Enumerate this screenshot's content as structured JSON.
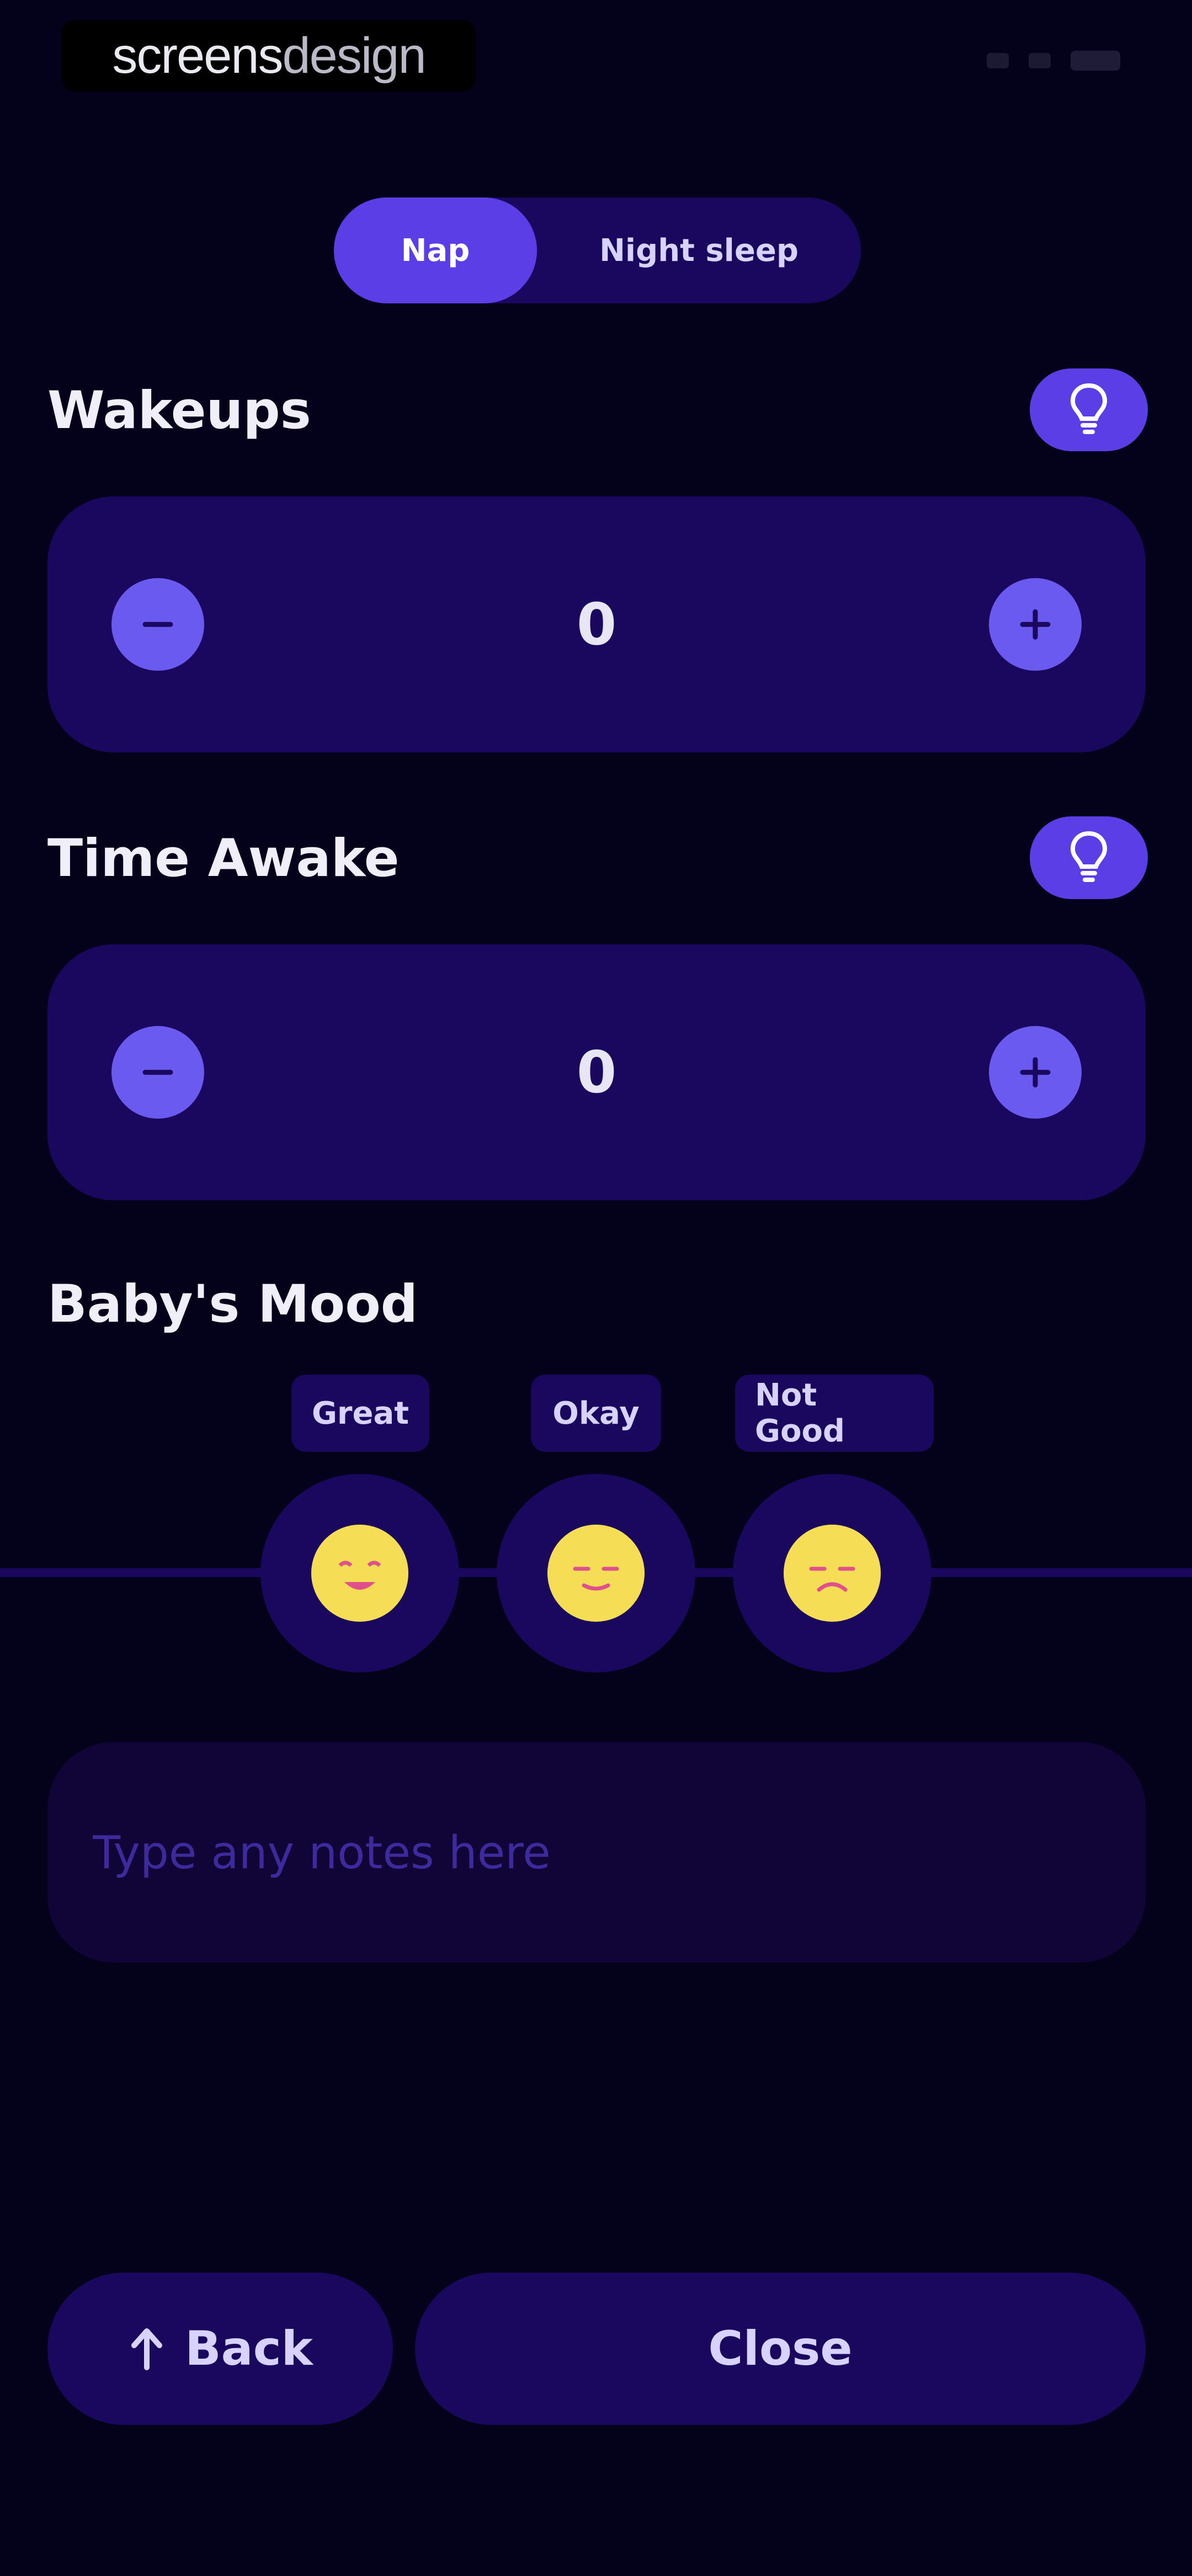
{
  "watermark": {
    "bold": "screens",
    "thin": "design"
  },
  "toggle": {
    "nap": "Nap",
    "night_sleep": "Night sleep"
  },
  "wakeups": {
    "title": "Wakeups",
    "value": "0"
  },
  "time_awake": {
    "title": "Time Awake",
    "value": "0"
  },
  "mood": {
    "title": "Baby's Mood",
    "options": [
      {
        "label": "Great"
      },
      {
        "label": "Okay"
      },
      {
        "label": "Not Good"
      }
    ]
  },
  "notes": {
    "placeholder": "Type any notes here"
  },
  "actions": {
    "back": "Back",
    "close": "Close"
  },
  "icons": {
    "hint": "lightbulb-icon",
    "minus": "minus-icon",
    "plus": "plus-icon",
    "back": "arrow-up-icon"
  },
  "colors": {
    "background": "#03021a",
    "card": "#1a085e",
    "accent": "#5b3ee6",
    "stepper": "#6b5af0",
    "face": "#f5dd55"
  }
}
